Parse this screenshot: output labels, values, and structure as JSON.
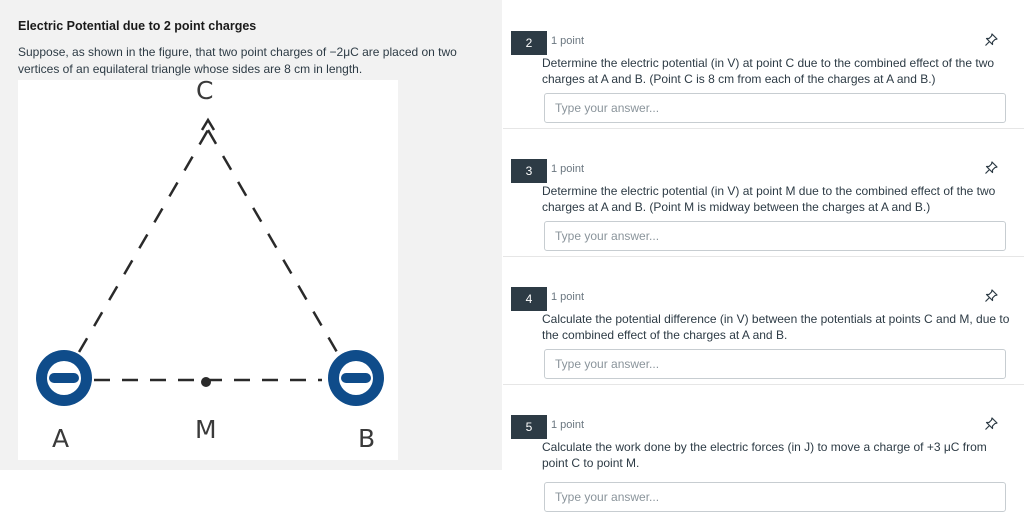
{
  "context": {
    "title": "Electric Potential due to 2 point charges",
    "description": "Suppose, as shown in the figure, that two point charges of −2μC are placed on two vertices of an equilateral triangle whose sides are 8 cm in length.",
    "figure": {
      "labels": {
        "top": "C",
        "left": "A",
        "middle": "M",
        "right": "B"
      },
      "colors": {
        "charge": "#0f4c8a",
        "dash": "#2a2a2a"
      }
    }
  },
  "questions": [
    {
      "number": "2",
      "points": "1 point",
      "text": "Determine the electric potential (in V) at point C due to the combined effect of the two charges at A and B. (Point C is 8 cm from each of the charges at A and B.)",
      "placeholder": "Type your answer..."
    },
    {
      "number": "3",
      "points": "1 point",
      "text": "Determine the electric potential (in V) at point M due to the combined effect of the two charges at A and B. (Point M is midway between the charges at A and B.)",
      "placeholder": "Type your answer..."
    },
    {
      "number": "4",
      "points": "1 point",
      "text": "Calculate the potential difference (in V) between the potentials at points C and M, due to the combined effect of the charges at A and B.",
      "placeholder": "Type your answer..."
    },
    {
      "number": "5",
      "points": "1 point",
      "text": "Calculate the work done by the electric forces (in J) to move a charge of +3 μC from point C to point M.",
      "placeholder": "Type your answer..."
    }
  ],
  "icons": {
    "pin": "pin-icon"
  },
  "theme": {
    "badge_bg": "#2d3b45",
    "panel_bg": "#f2f2f2",
    "input_border": "#c7cdd1"
  }
}
